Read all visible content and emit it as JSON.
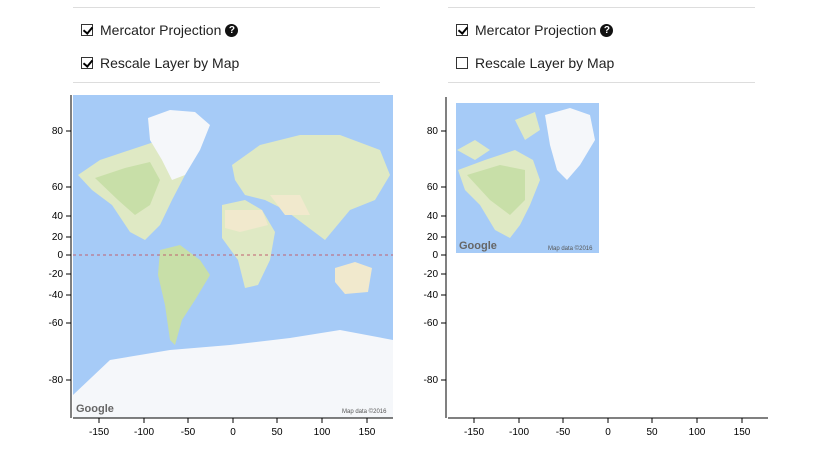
{
  "panels": [
    {
      "mercator": {
        "label": "Mercator Projection",
        "checked": true
      },
      "rescale": {
        "label": "Rescale Layer by Map",
        "checked": true
      },
      "help_glyph": "?",
      "y_ticks": [
        "80",
        "60",
        "40",
        "20",
        "0",
        "-20",
        "-40",
        "-60",
        "-80"
      ],
      "x_ticks": [
        "-150",
        "-100",
        "-50",
        "0",
        "50",
        "100",
        "150"
      ],
      "map_logo": "Google",
      "map_credit": "Map data ©2016"
    },
    {
      "mercator": {
        "label": "Mercator Projection",
        "checked": true
      },
      "rescale": {
        "label": "Rescale Layer by Map",
        "checked": false
      },
      "help_glyph": "?",
      "y_ticks": [
        "80",
        "60",
        "40",
        "20",
        "0",
        "-20",
        "-40",
        "-60",
        "-80"
      ],
      "x_ticks": [
        "-150",
        "-100",
        "-50",
        "0",
        "50",
        "100",
        "150"
      ],
      "map_logo": "Google",
      "map_credit": "Map data ©2016"
    }
  ],
  "colors": {
    "ocean": "#a6cbf7",
    "land": "#dfe9c4",
    "forest": "#c8dfa8",
    "desert": "#f1e9cd",
    "ice": "#f5f7fa",
    "equator": "#c06070"
  }
}
